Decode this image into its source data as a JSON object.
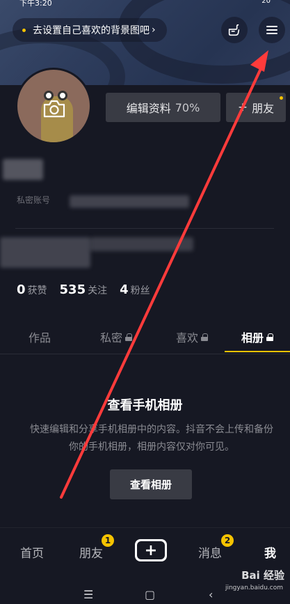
{
  "status_bar": {
    "time": "下午3:20",
    "right": "20"
  },
  "header": {
    "background_tip": "去设置自己喜欢的背景图吧",
    "tip_chevron": "›",
    "icons": [
      "hand-icon",
      "menu-icon"
    ]
  },
  "profile": {
    "edit_label": "编辑资料",
    "edit_progress": "70%",
    "friend_plus": "+",
    "friend_label": "朋友",
    "account_label": "私密账号"
  },
  "stats": [
    {
      "value": "0",
      "label": "获赞"
    },
    {
      "value": "535",
      "label": "关注"
    },
    {
      "value": "4",
      "label": "粉丝"
    }
  ],
  "tabs": [
    {
      "label": "作品",
      "locked": false
    },
    {
      "label": "私密",
      "locked": true
    },
    {
      "label": "喜欢",
      "locked": true
    },
    {
      "label": "相册",
      "locked": true,
      "active": true
    }
  ],
  "empty_state": {
    "title": "查看手机相册",
    "description": "快速编辑和分享手机相册中的内容。抖音不会上传和备份你的手机相册，相册内容仅对你可见。",
    "button": "查看相册"
  },
  "bottom_nav": {
    "home": "首页",
    "friends": "朋友",
    "friends_badge": "1",
    "plus": "+",
    "messages": "消息",
    "messages_badge": "2",
    "me": "我"
  },
  "system_nav": {
    "menu": "☰",
    "home": "▢",
    "back": "‹"
  },
  "watermark": {
    "brand": "Bai 经验",
    "url": "jingyan.baidu.com"
  },
  "colors": {
    "accent": "#f5c300",
    "background": "#161823",
    "button": "#393b44",
    "arrow": "#ff3b3b"
  }
}
